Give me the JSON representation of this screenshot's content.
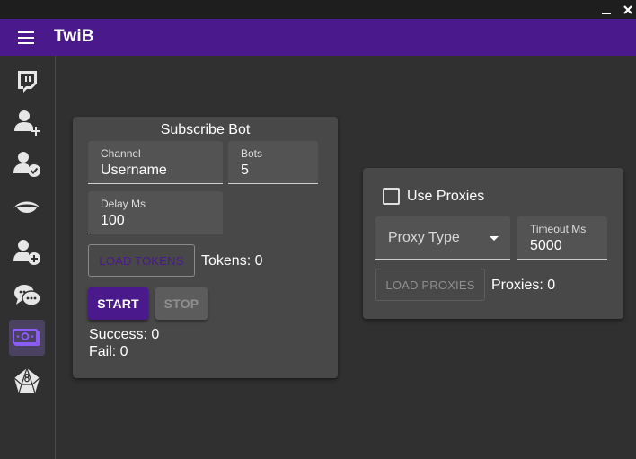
{
  "window": {
    "minimize_icon": "minimize-icon",
    "close_icon": "close-icon"
  },
  "appbar": {
    "title": "TwiB",
    "menu_icon": "hamburger-menu-icon",
    "color": "#4a1a8c"
  },
  "sidebar": {
    "items": [
      {
        "icon": "twitch-icon",
        "active": false
      },
      {
        "icon": "user-plus-icon",
        "active": false
      },
      {
        "icon": "user-check-icon",
        "active": false
      },
      {
        "icon": "eye-icon",
        "active": false
      },
      {
        "icon": "user-add-circle-icon",
        "active": false
      },
      {
        "icon": "chat-icon",
        "active": false
      },
      {
        "icon": "money-icon",
        "active": true
      },
      {
        "icon": "dice-icon",
        "active": false
      }
    ]
  },
  "subscribe": {
    "title": "Subscribe Bot",
    "channel_label": "Channel",
    "channel_value": "Username",
    "bots_label": "Bots",
    "bots_value": "5",
    "delay_label": "Delay Ms",
    "delay_value": "100",
    "load_tokens": "LOAD TOKENS",
    "tokens": "Tokens: 0",
    "start": "START",
    "stop": "STOP",
    "success": "Success: 0",
    "fail": "Fail: 0"
  },
  "proxies": {
    "use_proxies": "Use Proxies",
    "proxy_type": "Proxy Type",
    "timeout_label": "Timeout Ms",
    "timeout_value": "5000",
    "load_proxies": "LOAD PROXIES",
    "proxies_count": "Proxies: 0"
  }
}
